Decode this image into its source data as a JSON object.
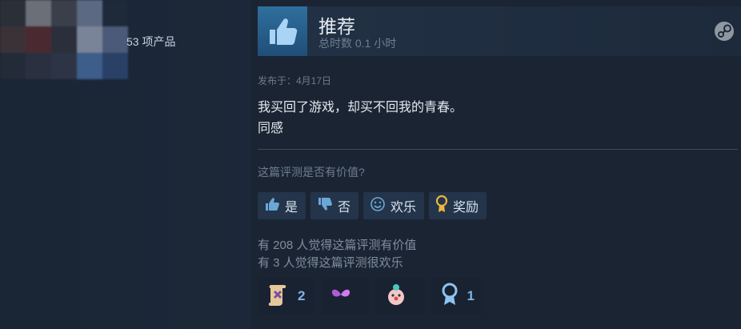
{
  "profile": {
    "product_count_text": "53 项产品"
  },
  "review": {
    "recommendation": "推荐",
    "hours": "总时数 0.1 小时",
    "posted": "发布于：4月17日",
    "body_lines": [
      "我买回了游戏，却买不回我的青春。",
      "同感"
    ],
    "helpful_question": "这篇评测是否有价值?",
    "buttons": {
      "yes": "是",
      "no": "否",
      "funny": "欢乐",
      "award": "奖励"
    },
    "stats": {
      "helpful": "有 208 人觉得这篇评测有价值",
      "funny": "有 3 人觉得这篇评测很欢乐"
    },
    "awards": [
      {
        "icon": "scroll-award-icon",
        "count": "2"
      },
      {
        "icon": "butterfly-award-icon",
        "count": ""
      },
      {
        "icon": "clown-award-icon",
        "count": ""
      },
      {
        "icon": "ribbon-award-icon",
        "count": "1"
      }
    ]
  },
  "colors": {
    "background": "#1b2738",
    "accent_blue": "#2f6f9e",
    "award_count": "#7fb3e6"
  }
}
